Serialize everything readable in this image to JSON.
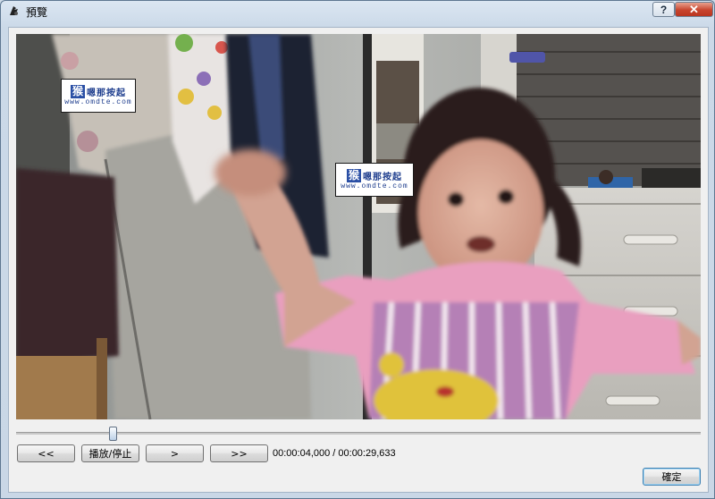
{
  "window": {
    "title": "預覽",
    "help_label": "?",
    "close_label": "✕",
    "app_icon": "app-icon"
  },
  "video": {
    "description_icon": "video-frame",
    "watermarks": [
      {
        "badge": "猴",
        "text": "嗯那按起",
        "url": "www.omdte.com"
      },
      {
        "badge": "猴",
        "text": "嗯那按起",
        "url": "www.omdte.com"
      }
    ]
  },
  "slider": {
    "position_fraction": 0.137
  },
  "controls": {
    "rewind_label": "<<",
    "play_stop_label": "播放/停止",
    "step_label": ">",
    "forward_label": ">>",
    "timecode": "00:00:04,000 / 00:00:29,633",
    "ok_label": "確定"
  }
}
